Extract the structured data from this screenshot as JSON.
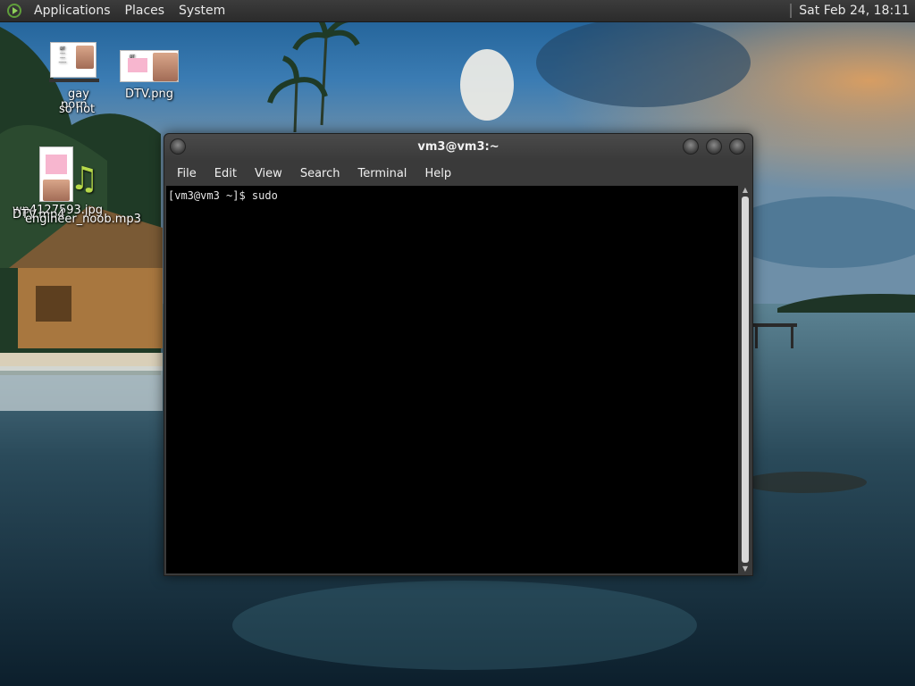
{
  "top_panel": {
    "menus": [
      "Applications",
      "Places",
      "System"
    ],
    "clock": "Sat Feb 24, 18:11"
  },
  "desktop_icons": [
    {
      "label_lines": [
        "gay",
        "porn",
        "so hot"
      ],
      "icon": "document-thumbnail-icon"
    },
    {
      "label_lines": [
        "DTV.png"
      ],
      "icon": "image-thumbnail-icon"
    },
    {
      "label_lines": [
        "wp4127593.jpg",
        "DTV.mp4",
        "engineer_noob.mp3"
      ],
      "icon": "music-note-icon"
    }
  ],
  "terminal": {
    "title": "vm3@vm3:~",
    "menus": [
      "File",
      "Edit",
      "View",
      "Search",
      "Terminal",
      "Help"
    ],
    "prompt": "[vm3@vm3 ~]$ sudo"
  },
  "colors": {
    "panel_bg": "#2f2f2f",
    "terminal_bg": "#000000",
    "terminal_fg": "#e6e6e6",
    "window_frame": "#3a3a3a"
  }
}
